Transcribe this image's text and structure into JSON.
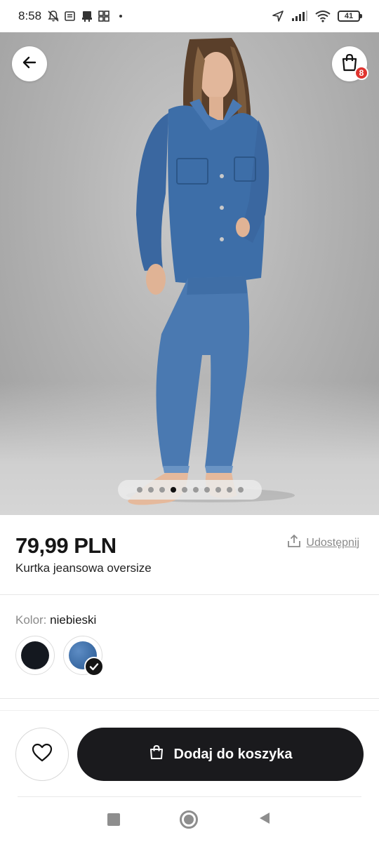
{
  "status_bar": {
    "time": "8:58",
    "battery": "41",
    "icons": [
      "notifications-off-icon",
      "news-icon",
      "store-icon",
      "grid-icon",
      "dot-icon",
      "location-arrow-icon",
      "signal-icon",
      "wifi-icon",
      "battery-icon"
    ]
  },
  "header": {
    "back_icon": "arrow-left-icon",
    "cart_icon": "shopping-bag-icon",
    "cart_count": "8"
  },
  "gallery": {
    "total_images": 10,
    "active_index": 3
  },
  "product": {
    "price": "79,99 PLN",
    "name": "Kurtka jeansowa oversize",
    "share_label": "Udostępnij"
  },
  "color": {
    "label": "Kolor:",
    "selected_value": "niebieski",
    "swatches": [
      {
        "color": "#14181f",
        "selected": false
      },
      {
        "color": "#3f6fa8",
        "selected": true
      }
    ]
  },
  "actions": {
    "wishlist_icon": "heart-icon",
    "add_to_cart_label": "Dodaj do koszyka",
    "add_to_cart_icon": "shopping-bag-icon"
  },
  "colors": {
    "primary_button": "#1a1a1d",
    "badge": "#e0342f",
    "denim": "#3f6fa8"
  }
}
